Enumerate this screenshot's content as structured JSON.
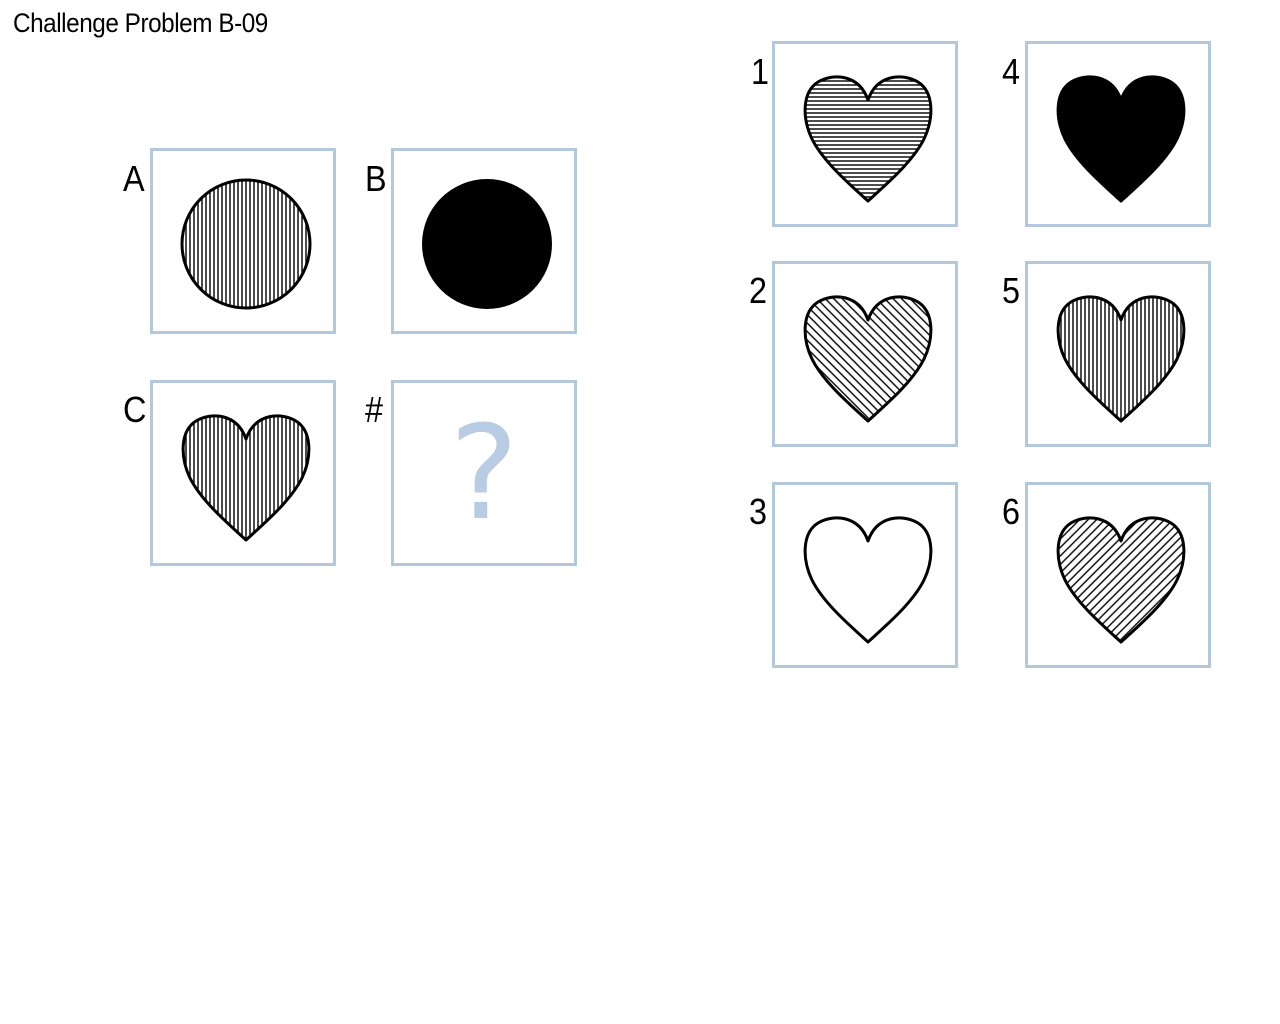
{
  "title": "Challenge Problem B-09",
  "matrix": [
    {
      "label": "A",
      "shape": "circle",
      "fill": "vertical-stripes"
    },
    {
      "label": "B",
      "shape": "circle",
      "fill": "solid"
    },
    {
      "label": "C",
      "shape": "heart",
      "fill": "vertical-stripes"
    },
    {
      "label": "#",
      "shape": "question",
      "text": "?"
    }
  ],
  "options": [
    {
      "label": "1",
      "shape": "heart",
      "fill": "horizontal-stripes"
    },
    {
      "label": "2",
      "shape": "heart",
      "fill": "diagonal-stripes-down"
    },
    {
      "label": "3",
      "shape": "heart",
      "fill": "none"
    },
    {
      "label": "4",
      "shape": "heart",
      "fill": "solid"
    },
    {
      "label": "5",
      "shape": "heart",
      "fill": "vertical-stripes"
    },
    {
      "label": "6",
      "shape": "heart",
      "fill": "diagonal-stripes-up"
    }
  ],
  "colors": {
    "cell_border": "#b4c8dc",
    "question_mark": "#b8cce4",
    "ink": "#000000"
  }
}
